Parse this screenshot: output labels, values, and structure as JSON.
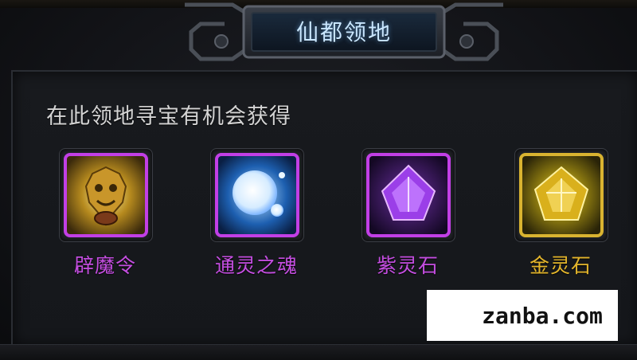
{
  "panel": {
    "title": "仙都领地",
    "description": "在此领地寻宝有机会获得"
  },
  "rewards": [
    {
      "name": "辟魔令",
      "icon": "golden-beast-token-icon",
      "rarity_color": "#c23fe6",
      "label_color": "#c44ee0"
    },
    {
      "name": "通灵之魂",
      "icon": "spirit-soul-orb-icon",
      "rarity_color": "#c23fe6",
      "label_color": "#c44ee0"
    },
    {
      "name": "紫灵石",
      "icon": "purple-spirit-stone-icon",
      "rarity_color": "#c23fe6",
      "label_color": "#c44ee0"
    },
    {
      "name": "金灵石",
      "icon": "gold-spirit-stone-icon",
      "rarity_color": "#d9b330",
      "label_color": "#e3b52c"
    }
  ],
  "watermark": {
    "text": "zanba.com"
  }
}
